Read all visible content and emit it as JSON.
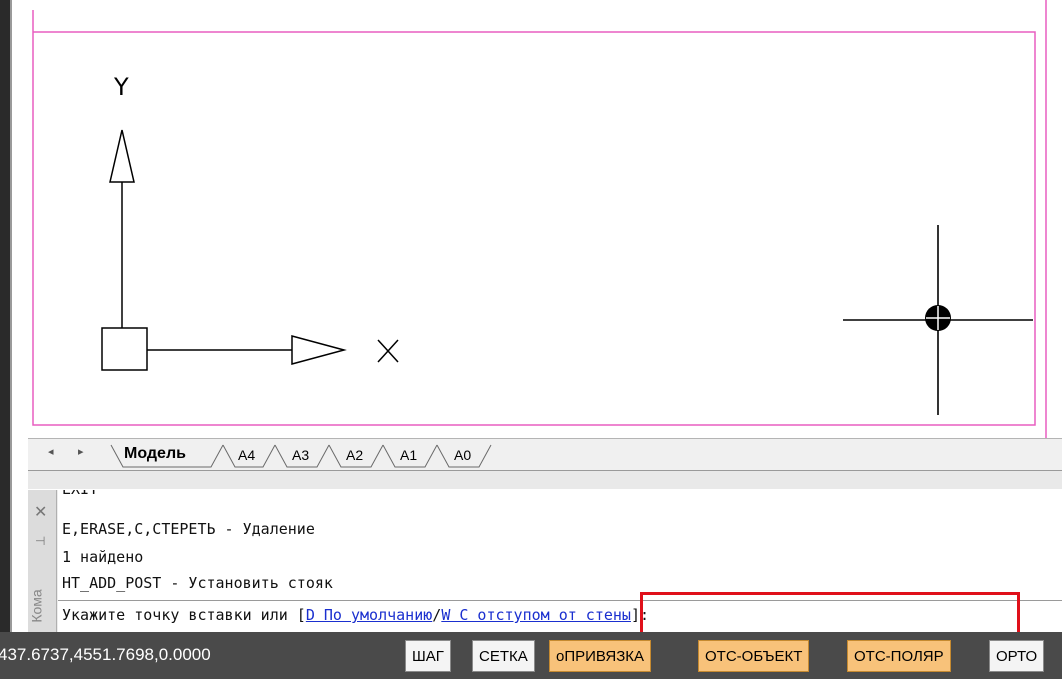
{
  "tabs": {
    "prev_icon": "◂",
    "next_icon": "▸",
    "items": [
      "Модель",
      "A4",
      "A3",
      "A2",
      "A1",
      "A0"
    ],
    "active": "Модель"
  },
  "axes": {
    "y_label": "Y",
    "x_label": "X"
  },
  "command": {
    "close_icon": "✕",
    "pin_icon": "⊣",
    "panel_label": "Кома",
    "history": [
      "EXIT",
      "E,ERASE,C,СТЕРЕТЬ - Удаление",
      "1 найдено",
      "HT_ADD_POST - Установить стояк"
    ],
    "prompt_prefix": "Укажите точку вставки или [",
    "option_default": "D По умолчанию",
    "option_separator": "/",
    "option_wall": "W С отступом от стены",
    "prompt_suffix": "]:"
  },
  "status": {
    "coordinates": "437.6737,4551.7698,0.0000",
    "buttons": [
      {
        "label": "ШАГ",
        "state": "off"
      },
      {
        "label": "СЕТКА",
        "state": "off"
      },
      {
        "label": "оПРИВЯЗКА",
        "state": "on"
      },
      {
        "label": "ОТС-ОБЪЕКТ",
        "state": "on"
      },
      {
        "label": "ОТС-ПОЛЯР",
        "state": "on"
      },
      {
        "label": "ОРТО",
        "state": "off"
      }
    ]
  },
  "colors": {
    "page_border": "#e85fc0",
    "highlight": "#e0101a",
    "link": "#1a2fcf",
    "status_on": "#f8c27a"
  }
}
